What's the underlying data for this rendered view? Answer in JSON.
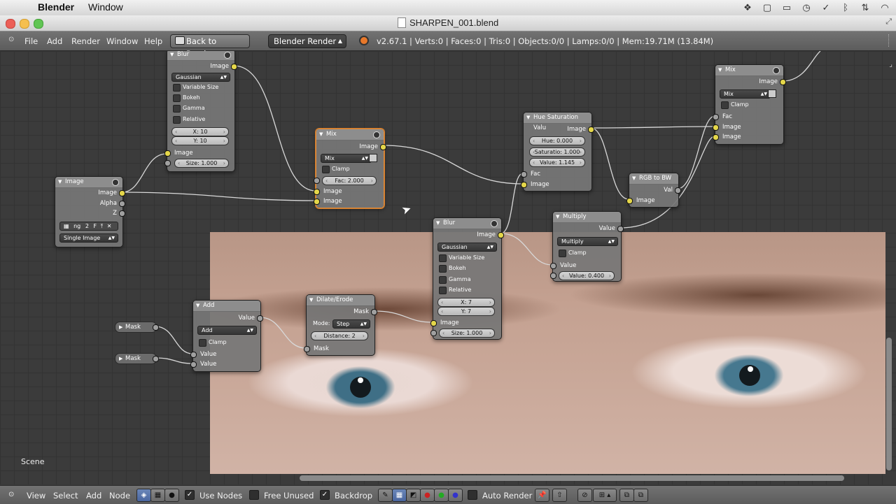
{
  "mac_menubar": {
    "app": "Blender",
    "menu": [
      "Window"
    ]
  },
  "window": {
    "title": "SHARPEN_001.blend"
  },
  "info_header": {
    "menus": [
      "File",
      "Add",
      "Render",
      "Window",
      "Help"
    ],
    "back_button": "Back to Previous",
    "render_engine": "Blender Render",
    "stats": "v2.67.1 | Verts:0 | Faces:0 | Tris:0 | Objects:0/0 | Lamps:0/0 | Mem:19.71M (13.84M)"
  },
  "editor": {
    "scene_label": "Scene",
    "nodes": {
      "blur1": {
        "title": "Blur",
        "out_image": "Image",
        "filter": "Gaussian",
        "checks": [
          "Variable Size",
          "Bokeh",
          "Gamma",
          "Relative"
        ],
        "x": "X: 10",
        "y": "Y: 10",
        "in_image": "Image",
        "size": "Size: 1.000"
      },
      "image": {
        "title": "Image",
        "out_image": "Image",
        "out_alpha": "Alpha",
        "out_z": "Z",
        "file": "ng",
        "users": "2",
        "fake": "F",
        "source": "Single Image"
      },
      "mix1": {
        "title": "Mix",
        "out_image": "Image",
        "blend": "Mix",
        "clamp": "Clamp",
        "fac": "Fac: 2.000",
        "in_image1": "Image",
        "in_image2": "Image"
      },
      "hue": {
        "title": "Hue Saturation Valu",
        "out_image": "Image",
        "hue": "Hue: 0.000",
        "sat": "Saturatio: 1.000",
        "val": "Value: 1.145",
        "in_fac": "Fac",
        "in_image": "Image"
      },
      "mix2": {
        "title": "Mix",
        "out_image": "Image",
        "blend": "Mix",
        "clamp": "Clamp",
        "in_fac": "Fac",
        "in_image1": "Image",
        "in_image2": "Image"
      },
      "rgbbw": {
        "title": "RGB to BW",
        "out_val": "Val",
        "in_image": "Image"
      },
      "multiply": {
        "title": "Multiply",
        "out_value": "Value",
        "op": "Multiply",
        "clamp": "Clamp",
        "in_value": "Value",
        "value": "Value: 0.400"
      },
      "blur2": {
        "title": "Blur",
        "out_image": "Image",
        "filter": "Gaussian",
        "checks": [
          "Variable Size",
          "Bokeh",
          "Gamma",
          "Relative"
        ],
        "x": "X: 7",
        "y": "Y: 7",
        "in_image": "Image",
        "size": "Size: 1.000"
      },
      "dilate": {
        "title": "Dilate/Erode",
        "out_mask": "Mask",
        "mode_label": "Mode:",
        "mode": "Step",
        "distance": "Distance: 2",
        "in_mask": "Mask"
      },
      "add": {
        "title": "Add",
        "out_value": "Value",
        "op": "Add",
        "clamp": "Clamp",
        "in_value1": "Value",
        "in_value2": "Value"
      },
      "mask1": {
        "title": "Mask"
      },
      "mask2": {
        "title": "Mask"
      }
    }
  },
  "bottom_header": {
    "menus": [
      "View",
      "Select",
      "Add",
      "Node"
    ],
    "use_nodes": "Use Nodes",
    "free_unused": "Free Unused",
    "backdrop": "Backdrop",
    "auto_render": "Auto Render"
  }
}
